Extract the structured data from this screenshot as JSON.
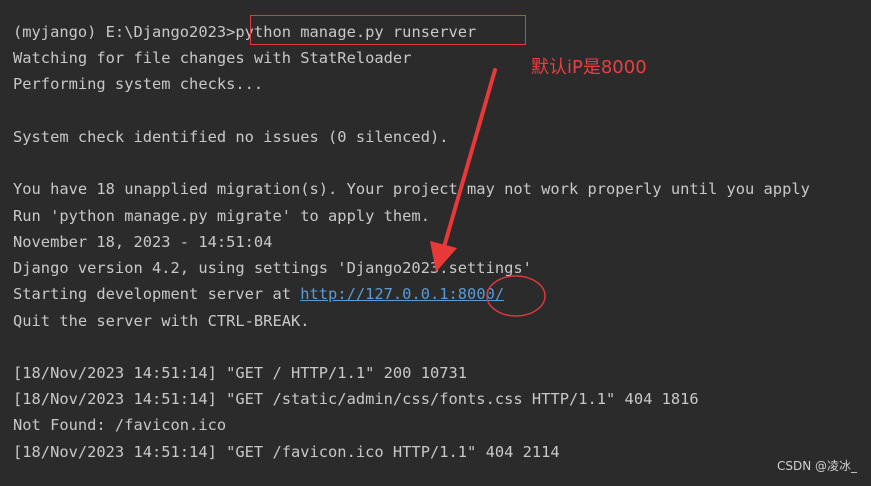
{
  "terminal": {
    "prompt": "(myjango) E:\\Django2023>",
    "command": "python manage.py runserver",
    "lines": {
      "watching": "Watching for file changes with StatReloader",
      "performing": "Performing system checks...",
      "check": "System check identified no issues (0 silenced).",
      "migrations": "You have 18 unapplied migration(s). Your project may not work properly until you apply",
      "run_migrate": "Run 'python manage.py migrate' to apply them.",
      "datetime": "November 18, 2023 - 14:51:04",
      "django_version": "Django version 4.2, using settings 'Django2023.settings'",
      "starting_prefix": "Starting development server at ",
      "server_url_host": "http://127.0.0.1:",
      "server_url_port": "8000/",
      "quit": "Quit the server with CTRL-BREAK.",
      "log1": "[18/Nov/2023 14:51:14] \"GET / HTTP/1.1\" 200 10731",
      "log2": "[18/Nov/2023 14:51:14] \"GET /static/admin/css/fonts.css HTTP/1.1\" 404 1816",
      "not_found": "Not Found: /favicon.ico",
      "log3": "[18/Nov/2023 14:51:14] \"GET /favicon.ico HTTP/1.1\" 404 2114"
    }
  },
  "annotation": {
    "note": "默认iP是8000",
    "color": "#ea3f3f"
  },
  "watermark": "CSDN @凌冰_",
  "colors": {
    "background": "#2b2b2b",
    "text": "#c8c8c8",
    "link": "#5a9bd5"
  }
}
